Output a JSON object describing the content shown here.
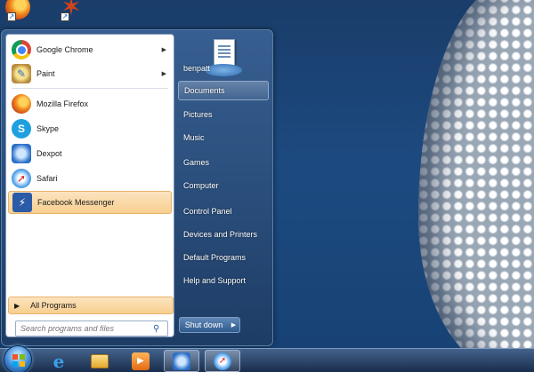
{
  "start_menu": {
    "programs": [
      {
        "label": "Google Chrome",
        "icon": "chrome-icon",
        "has_submenu": true
      },
      {
        "label": "Paint",
        "icon": "paint-icon",
        "has_submenu": true
      },
      {
        "label": "Mozilla Firefox",
        "icon": "firefox-icon",
        "has_submenu": false
      },
      {
        "label": "Skype",
        "icon": "skype-icon",
        "has_submenu": false
      },
      {
        "label": "Dexpot",
        "icon": "dexpot-icon",
        "has_submenu": false
      },
      {
        "label": "Safari",
        "icon": "safari-icon",
        "has_submenu": false
      },
      {
        "label": "Facebook Messenger",
        "icon": "messenger-icon",
        "has_submenu": false,
        "highlighted": true
      }
    ],
    "all_programs_label": "All Programs",
    "search_placeholder": "Search programs and files",
    "right_items": [
      {
        "label": "benpatt"
      },
      {
        "label": "Documents",
        "active": true
      },
      {
        "label": "Pictures"
      },
      {
        "label": "Music"
      },
      {
        "label": "Games"
      },
      {
        "label": "Computer"
      },
      {
        "label": "Control Panel"
      },
      {
        "label": "Devices and Printers"
      },
      {
        "label": "Default Programs"
      },
      {
        "label": "Help and Support"
      }
    ],
    "shutdown_label": "Shut down"
  },
  "taskbar": {
    "items": [
      {
        "icon": "internet-explorer-icon"
      },
      {
        "icon": "windows-explorer-icon"
      },
      {
        "icon": "media-player-icon"
      },
      {
        "icon": "dexpot-icon",
        "pressed": true
      },
      {
        "icon": "safari-icon",
        "pressed": true
      }
    ]
  },
  "desktop_icons": [
    {
      "icon": "firefox-icon"
    },
    {
      "icon": "app-shortcut-icon"
    }
  ],
  "colors": {
    "highlight": "#f7cf8f",
    "menu_bg": "#2a5a8f"
  }
}
